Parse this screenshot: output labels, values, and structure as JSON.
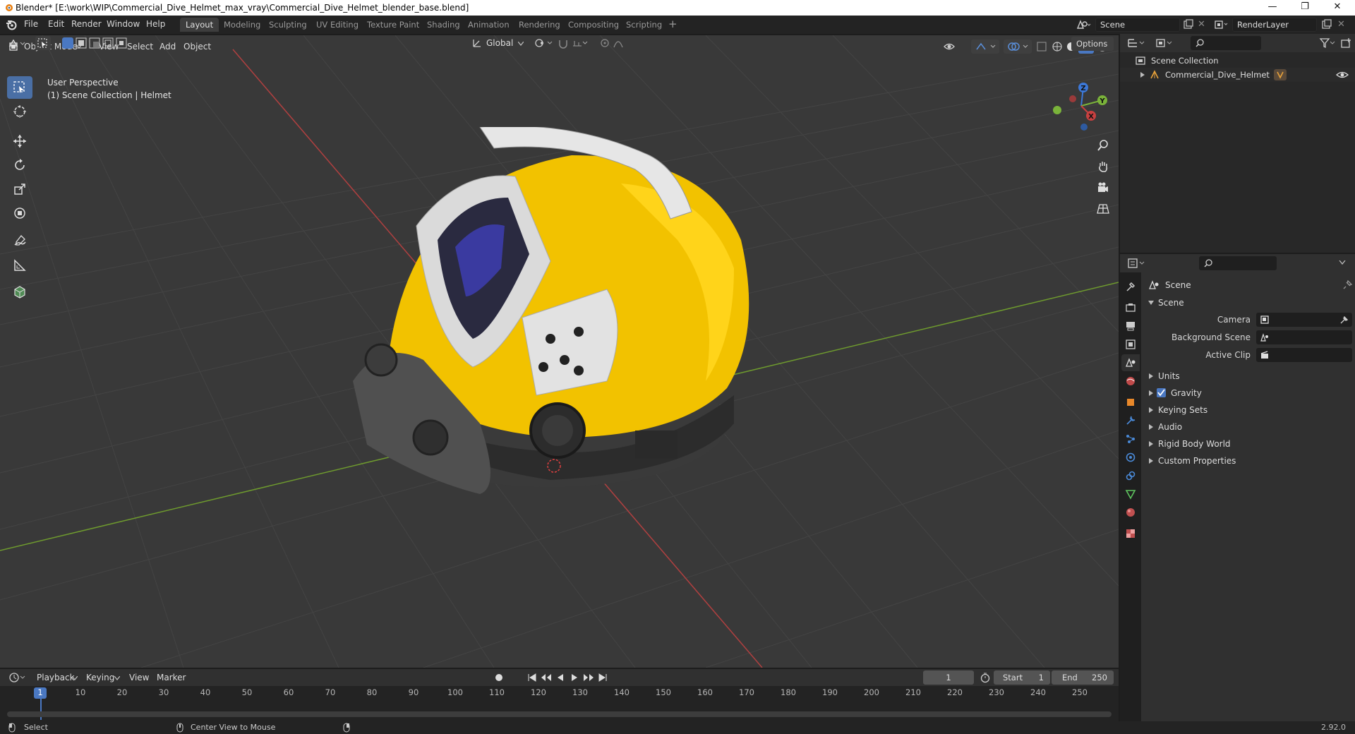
{
  "window": {
    "title": "Blender* [E:\\work\\WIP\\Commercial_Dive_Helmet_max_vray\\Commercial_Dive_Helmet_blender_base.blend]",
    "minimize": "—",
    "maximize": "❐",
    "close": "✕"
  },
  "menubar": {
    "items": [
      "File",
      "Edit",
      "Render",
      "Window",
      "Help"
    ]
  },
  "workspaces": {
    "tabs": [
      "Layout",
      "Modeling",
      "Sculpting",
      "UV Editing",
      "Texture Paint",
      "Shading",
      "Animation",
      "Rendering",
      "Compositing",
      "Scripting"
    ],
    "active": "Layout",
    "add": "+"
  },
  "scene_selector": {
    "value": "Scene"
  },
  "renderlayer_selector": {
    "value": "RenderLayer"
  },
  "viewport_toolbar": {
    "transform_orientation": "Global",
    "options": "Options"
  },
  "viewport_header": {
    "mode": "Object Mode",
    "menus": [
      "View",
      "Select",
      "Add",
      "Object"
    ]
  },
  "viewport": {
    "view_name": "User Perspective",
    "collection_info": "(1) Scene Collection | Helmet",
    "gizmo": {
      "x": "X",
      "y": "Y",
      "z": "Z"
    },
    "colors": {
      "x_axis": "#c84040",
      "y_axis": "#7ab33a",
      "z_axis": "#3c78d8"
    }
  },
  "outliner": {
    "root": "Scene Collection",
    "items": [
      {
        "label": "Commercial_Dive_Helmet"
      }
    ]
  },
  "properties": {
    "context": "Scene",
    "section": "Scene",
    "fields": [
      {
        "label": "Camera",
        "value": ""
      },
      {
        "label": "Background Scene",
        "value": ""
      },
      {
        "label": "Active Clip",
        "value": ""
      }
    ],
    "panels": [
      {
        "label": "Units",
        "checkbox": false
      },
      {
        "label": "Gravity",
        "checkbox": true
      },
      {
        "label": "Keying Sets",
        "checkbox": false
      },
      {
        "label": "Audio",
        "checkbox": false
      },
      {
        "label": "Rigid Body World",
        "checkbox": false
      },
      {
        "label": "Custom Properties",
        "checkbox": false
      }
    ]
  },
  "timeline": {
    "menus": [
      "Playback",
      "Keying",
      "View",
      "Marker"
    ],
    "current_frame": "1",
    "start_label": "Start",
    "start": "1",
    "end_label": "End",
    "end": "250",
    "ticks": [
      "1",
      "10",
      "20",
      "30",
      "40",
      "50",
      "60",
      "70",
      "80",
      "90",
      "100",
      "110",
      "120",
      "130",
      "140",
      "150",
      "160",
      "170",
      "180",
      "190",
      "200",
      "210",
      "220",
      "230",
      "240",
      "250"
    ]
  },
  "statusbar": {
    "left": "Select",
    "middle": "Center View to Mouse",
    "version": "2.92.0"
  },
  "accent": "#4a78c2"
}
